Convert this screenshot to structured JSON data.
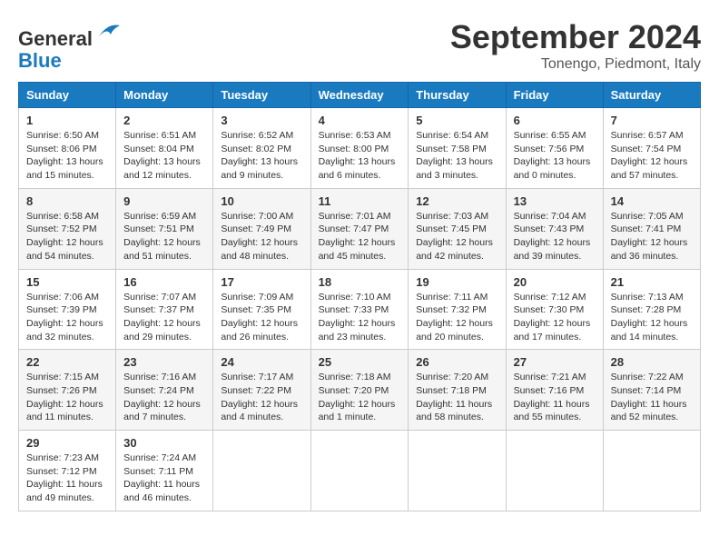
{
  "header": {
    "logo_line1": "General",
    "logo_line2": "Blue",
    "month": "September 2024",
    "location": "Tonengo, Piedmont, Italy"
  },
  "columns": [
    "Sunday",
    "Monday",
    "Tuesday",
    "Wednesday",
    "Thursday",
    "Friday",
    "Saturday"
  ],
  "weeks": [
    [
      {
        "day": "1",
        "sunrise": "6:50 AM",
        "sunset": "8:06 PM",
        "daylight": "13 hours and 15 minutes."
      },
      {
        "day": "2",
        "sunrise": "6:51 AM",
        "sunset": "8:04 PM",
        "daylight": "13 hours and 12 minutes."
      },
      {
        "day": "3",
        "sunrise": "6:52 AM",
        "sunset": "8:02 PM",
        "daylight": "13 hours and 9 minutes."
      },
      {
        "day": "4",
        "sunrise": "6:53 AM",
        "sunset": "8:00 PM",
        "daylight": "13 hours and 6 minutes."
      },
      {
        "day": "5",
        "sunrise": "6:54 AM",
        "sunset": "7:58 PM",
        "daylight": "13 hours and 3 minutes."
      },
      {
        "day": "6",
        "sunrise": "6:55 AM",
        "sunset": "7:56 PM",
        "daylight": "13 hours and 0 minutes."
      },
      {
        "day": "7",
        "sunrise": "6:57 AM",
        "sunset": "7:54 PM",
        "daylight": "12 hours and 57 minutes."
      }
    ],
    [
      {
        "day": "8",
        "sunrise": "6:58 AM",
        "sunset": "7:52 PM",
        "daylight": "12 hours and 54 minutes."
      },
      {
        "day": "9",
        "sunrise": "6:59 AM",
        "sunset": "7:51 PM",
        "daylight": "12 hours and 51 minutes."
      },
      {
        "day": "10",
        "sunrise": "7:00 AM",
        "sunset": "7:49 PM",
        "daylight": "12 hours and 48 minutes."
      },
      {
        "day": "11",
        "sunrise": "7:01 AM",
        "sunset": "7:47 PM",
        "daylight": "12 hours and 45 minutes."
      },
      {
        "day": "12",
        "sunrise": "7:03 AM",
        "sunset": "7:45 PM",
        "daylight": "12 hours and 42 minutes."
      },
      {
        "day": "13",
        "sunrise": "7:04 AM",
        "sunset": "7:43 PM",
        "daylight": "12 hours and 39 minutes."
      },
      {
        "day": "14",
        "sunrise": "7:05 AM",
        "sunset": "7:41 PM",
        "daylight": "12 hours and 36 minutes."
      }
    ],
    [
      {
        "day": "15",
        "sunrise": "7:06 AM",
        "sunset": "7:39 PM",
        "daylight": "12 hours and 32 minutes."
      },
      {
        "day": "16",
        "sunrise": "7:07 AM",
        "sunset": "7:37 PM",
        "daylight": "12 hours and 29 minutes."
      },
      {
        "day": "17",
        "sunrise": "7:09 AM",
        "sunset": "7:35 PM",
        "daylight": "12 hours and 26 minutes."
      },
      {
        "day": "18",
        "sunrise": "7:10 AM",
        "sunset": "7:33 PM",
        "daylight": "12 hours and 23 minutes."
      },
      {
        "day": "19",
        "sunrise": "7:11 AM",
        "sunset": "7:32 PM",
        "daylight": "12 hours and 20 minutes."
      },
      {
        "day": "20",
        "sunrise": "7:12 AM",
        "sunset": "7:30 PM",
        "daylight": "12 hours and 17 minutes."
      },
      {
        "day": "21",
        "sunrise": "7:13 AM",
        "sunset": "7:28 PM",
        "daylight": "12 hours and 14 minutes."
      }
    ],
    [
      {
        "day": "22",
        "sunrise": "7:15 AM",
        "sunset": "7:26 PM",
        "daylight": "12 hours and 11 minutes."
      },
      {
        "day": "23",
        "sunrise": "7:16 AM",
        "sunset": "7:24 PM",
        "daylight": "12 hours and 7 minutes."
      },
      {
        "day": "24",
        "sunrise": "7:17 AM",
        "sunset": "7:22 PM",
        "daylight": "12 hours and 4 minutes."
      },
      {
        "day": "25",
        "sunrise": "7:18 AM",
        "sunset": "7:20 PM",
        "daylight": "12 hours and 1 minute."
      },
      {
        "day": "26",
        "sunrise": "7:20 AM",
        "sunset": "7:18 PM",
        "daylight": "11 hours and 58 minutes."
      },
      {
        "day": "27",
        "sunrise": "7:21 AM",
        "sunset": "7:16 PM",
        "daylight": "11 hours and 55 minutes."
      },
      {
        "day": "28",
        "sunrise": "7:22 AM",
        "sunset": "7:14 PM",
        "daylight": "11 hours and 52 minutes."
      }
    ],
    [
      {
        "day": "29",
        "sunrise": "7:23 AM",
        "sunset": "7:12 PM",
        "daylight": "11 hours and 49 minutes."
      },
      {
        "day": "30",
        "sunrise": "7:24 AM",
        "sunset": "7:11 PM",
        "daylight": "11 hours and 46 minutes."
      },
      null,
      null,
      null,
      null,
      null
    ]
  ]
}
